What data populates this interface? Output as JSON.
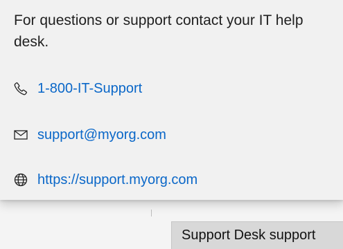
{
  "support_flyout": {
    "intro_text": "For questions or support contact your IT help desk.",
    "phone": {
      "icon": "phone-icon",
      "label": "1-800-IT-Support"
    },
    "email": {
      "icon": "mail-icon",
      "label": "support@myorg.com"
    },
    "website": {
      "icon": "globe-icon",
      "label": "https://support.myorg.com"
    },
    "link_color": "#0a67c8"
  },
  "tooltip": {
    "text": "Support Desk support"
  }
}
